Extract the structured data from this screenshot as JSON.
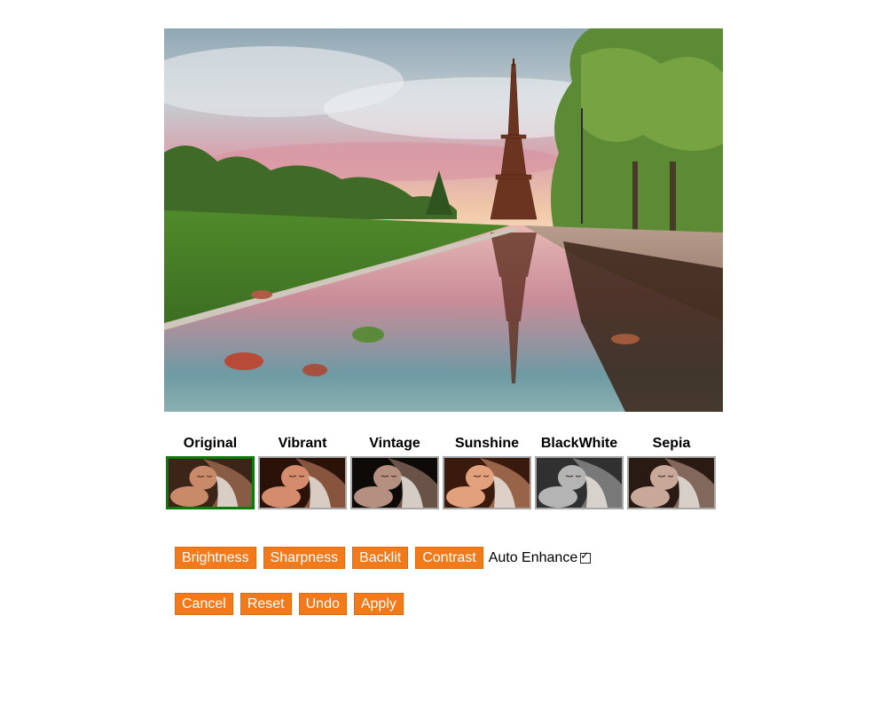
{
  "photo": {
    "description_icon": "eiffel-tower-photo"
  },
  "filters": [
    {
      "name": "Original",
      "selected": true,
      "tint": "#c98a6a",
      "dark": "#3b2418"
    },
    {
      "name": "Vibrant",
      "selected": false,
      "tint": "#d48c6c",
      "dark": "#2a1208"
    },
    {
      "name": "Vintage",
      "selected": false,
      "tint": "#b59080",
      "dark": "#0e0a08"
    },
    {
      "name": "Sunshine",
      "selected": false,
      "tint": "#e3a07c",
      "dark": "#3a1a0c"
    },
    {
      "name": "BlackWhite",
      "selected": false,
      "tint": "#b4b4b4",
      "dark": "#303030"
    },
    {
      "name": "Sepia",
      "selected": false,
      "tint": "#c8a898",
      "dark": "#2a1a14"
    }
  ],
  "tools": {
    "brightness": "Brightness",
    "sharpness": "Sharpness",
    "backlit": "Backlit",
    "contrast": "Contrast",
    "auto_enhance": "Auto Enhance",
    "auto_enhance_checked": true
  },
  "actions": {
    "cancel": "Cancel",
    "reset": "Reset",
    "undo": "Undo",
    "apply": "Apply"
  },
  "colors": {
    "button_bg": "#f37a1b",
    "selected_border": "#0a7a0a"
  }
}
